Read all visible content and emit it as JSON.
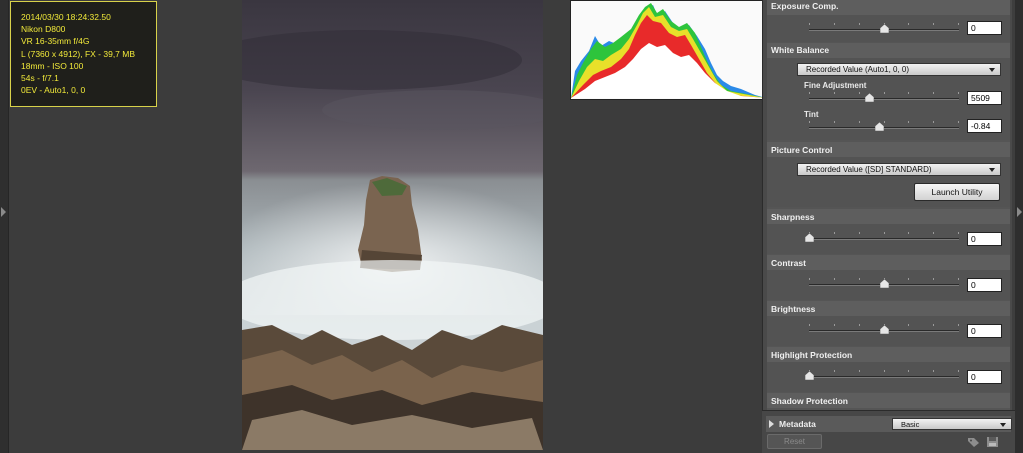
{
  "info": {
    "lines": [
      "2014/03/30 18:24:32.50",
      "Nikon D800",
      "VR 16-35mm f/4G",
      "L (7360 x 4912), FX - 39,7 MB",
      "18mm - ISO 100",
      "54s - f/7.1",
      "0EV - Auto1, 0, 0"
    ]
  },
  "panel": {
    "exposure": {
      "title": "Exposure Comp.",
      "value": "0",
      "level": 0.5
    },
    "white_balance": {
      "title": "White Balance",
      "mode": "Recorded Value (Auto1, 0, 0)",
      "fine_label": "Fine Adjustment",
      "fine_value": "5509",
      "fine_level": 0.4,
      "tint_label": "Tint",
      "tint_value": "-0.84",
      "tint_level": 0.47
    },
    "picture_control": {
      "title": "Picture Control",
      "mode": "Recorded Value ([SD] STANDARD)",
      "launch_label": "Launch Utility"
    },
    "sharpness": {
      "title": "Sharpness",
      "value": "0",
      "level": 0.0
    },
    "contrast": {
      "title": "Contrast",
      "value": "0",
      "level": 0.5
    },
    "brightness": {
      "title": "Brightness",
      "value": "0",
      "level": 0.5
    },
    "highlight": {
      "title": "Highlight Protection",
      "value": "0",
      "level": 0.0
    },
    "shadow": {
      "title": "Shadow Protection"
    }
  },
  "footer": {
    "metadata_label": "Metadata",
    "metadata_mode": "Basic",
    "reset_label": "Reset"
  },
  "colors": {
    "info_text": "#f2ea3a",
    "info_border": "#d8d24a",
    "panel_bg": "#555555"
  },
  "icons": {
    "left_toggle": "triangle-right",
    "right_toggle": "triangle-right",
    "metadata_toggle": "triangle-right",
    "footer_icon_1": "tag-icon",
    "footer_icon_2": "save-icon"
  }
}
